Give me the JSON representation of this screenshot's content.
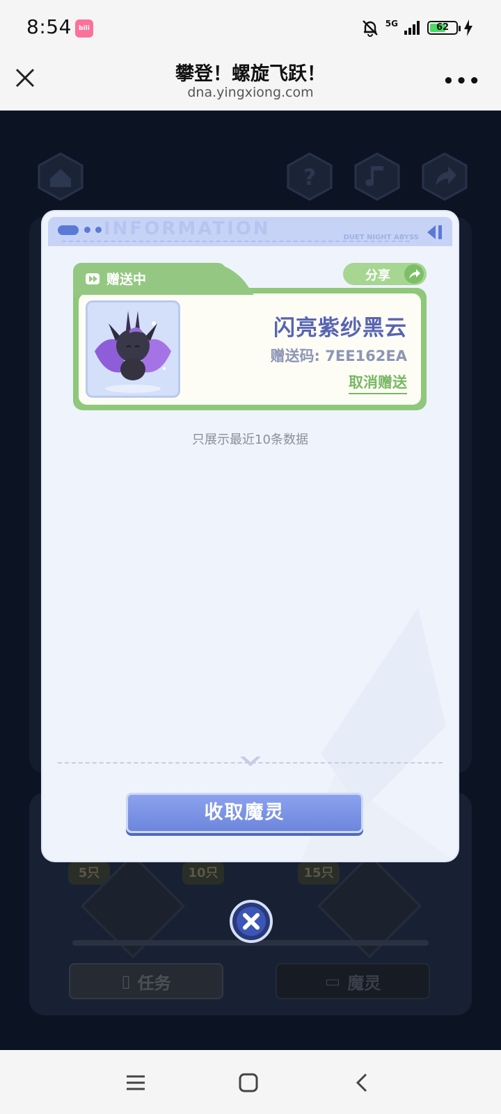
{
  "status_bar": {
    "time": "8:54",
    "app_badge": "bilibili",
    "network": "5G",
    "battery": "62",
    "battery_level": 0.62
  },
  "browser": {
    "title": "攀登！螺旋飞跃！",
    "url": "dna.yingxiong.com"
  },
  "modal": {
    "header_brand": "DUET NIGHT ABYSS",
    "header_watermark": "INFORMATION",
    "record": {
      "status_label": "赠送中",
      "share_label": "分享",
      "name": "闪亮紫纱黑云",
      "code": "赠送码: 7EE162EA",
      "cancel_label": "取消赠送"
    },
    "notice": "只展示最近10条数据",
    "collect_button": "收取魔灵"
  },
  "background_game": {
    "milestones": [
      "5只",
      "10只",
      "15只"
    ],
    "tabs": [
      "任务",
      "魔灵"
    ]
  },
  "colors": {
    "accent_green": "#94c882",
    "accent_blue": "#6d86dd",
    "sprite_name": "#5864b3"
  }
}
